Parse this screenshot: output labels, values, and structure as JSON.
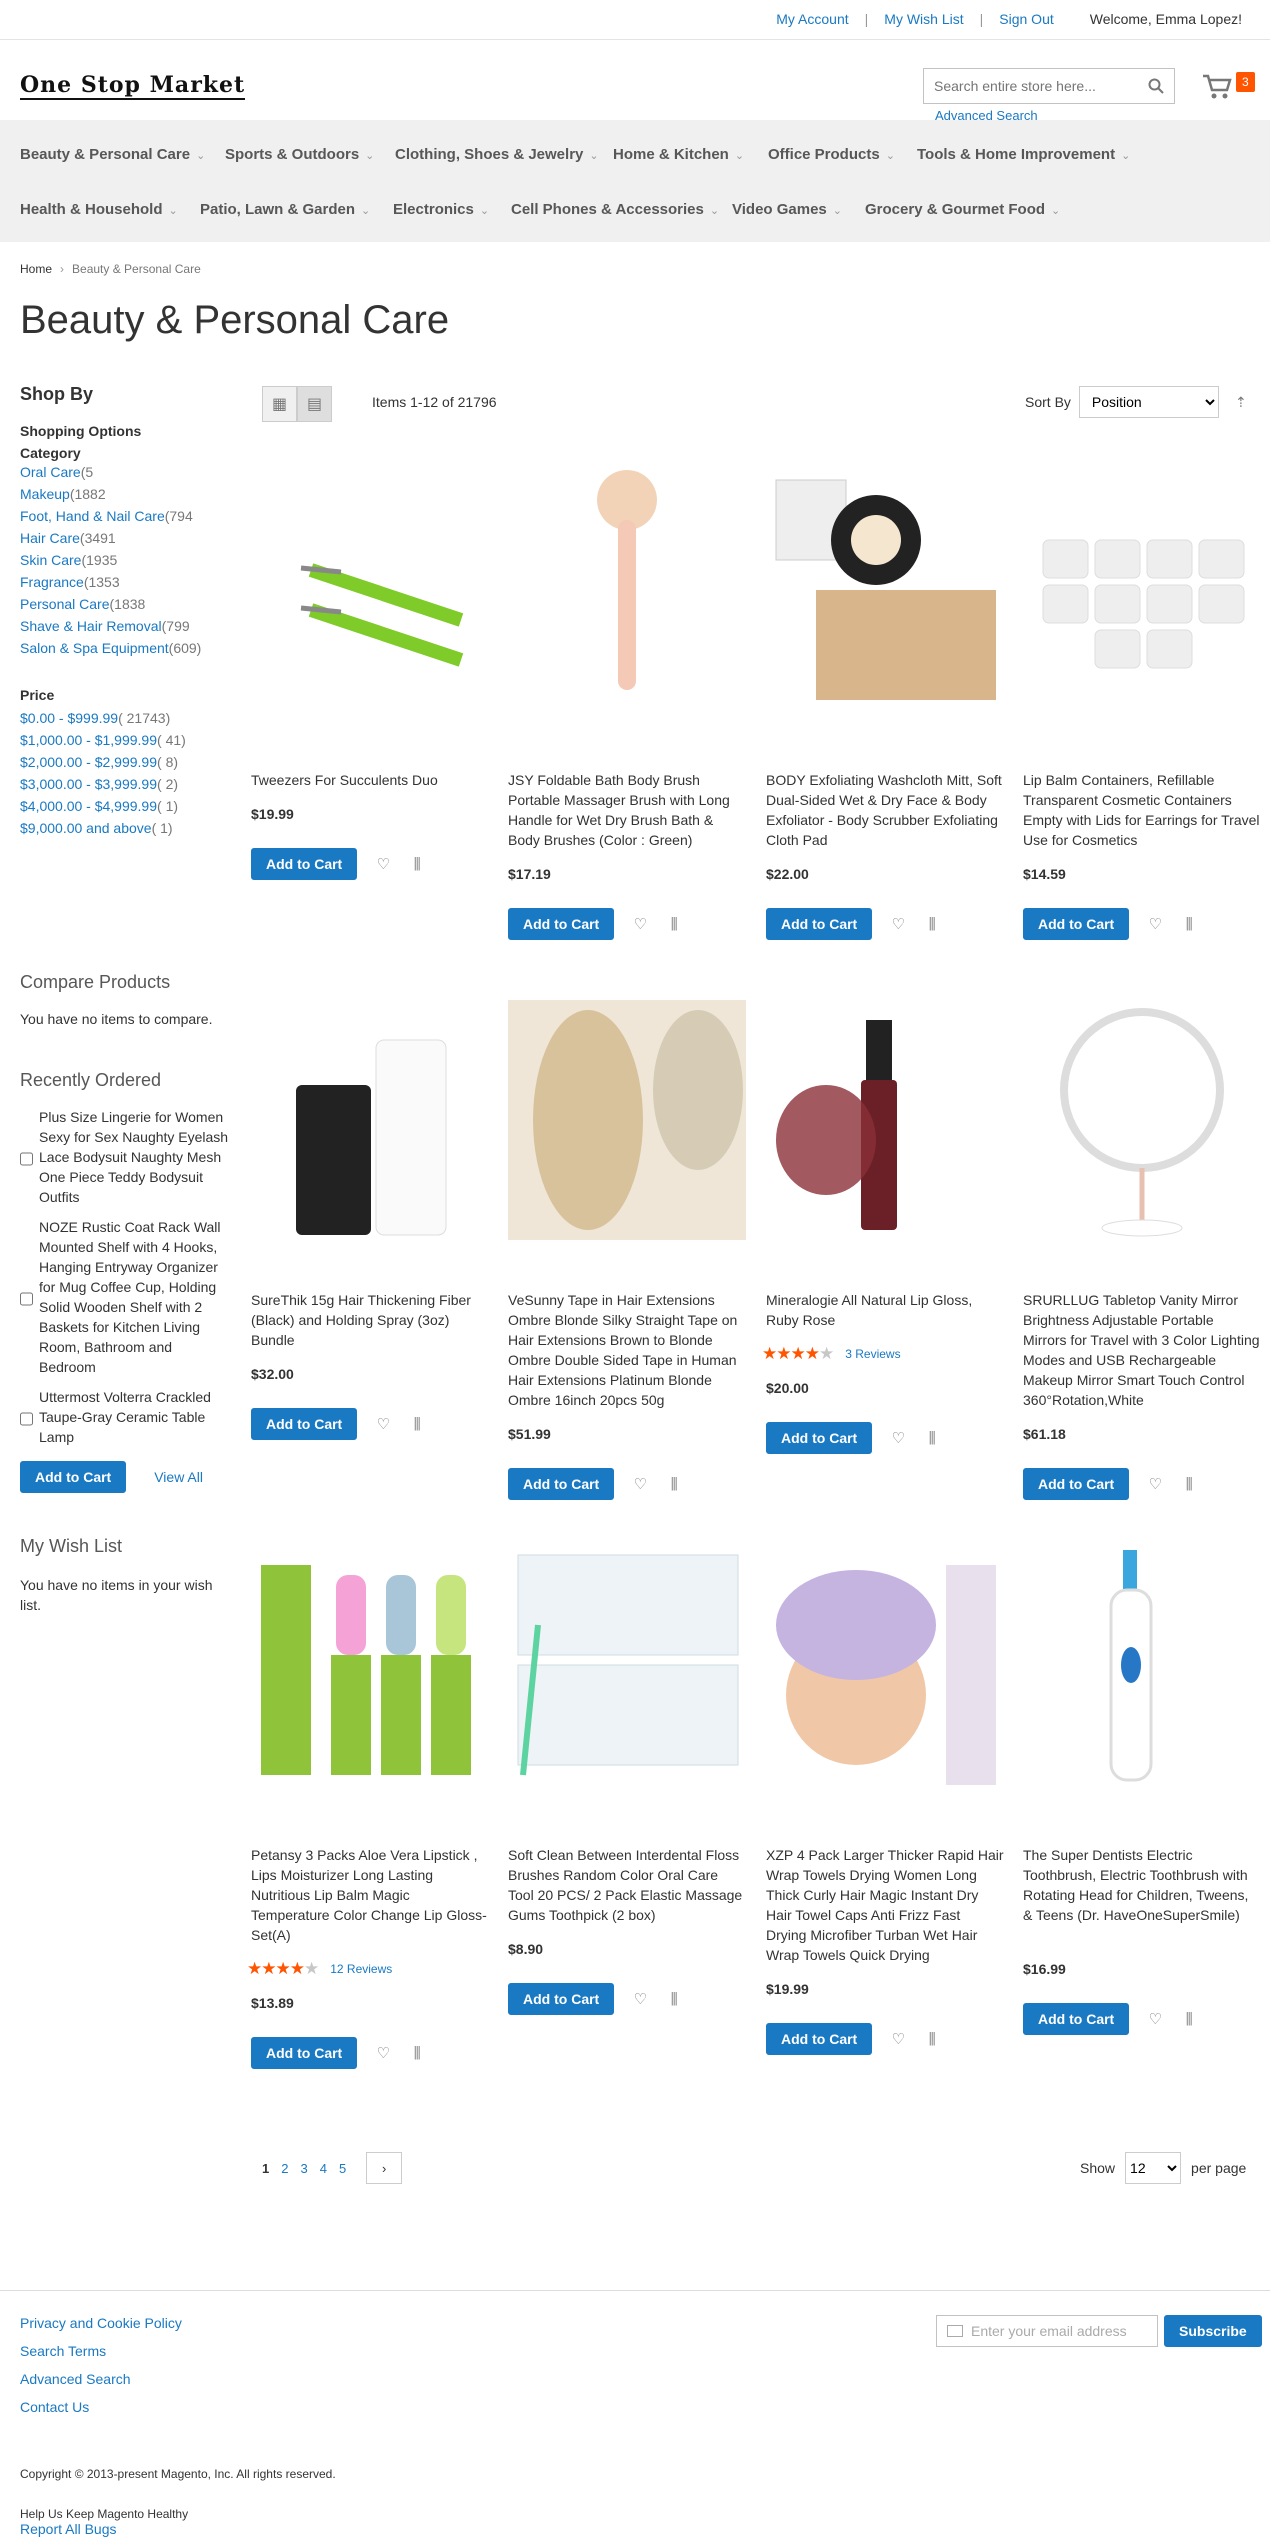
{
  "header": {
    "my_account": "My Account",
    "my_wish_list": "My Wish List",
    "sign_out": "Sign Out",
    "welcome": "Welcome, Emma Lopez!",
    "logo": "One Stop Market",
    "search_placeholder": "Search entire store here...",
    "advanced_search": "Advanced Search",
    "cart_count": "3"
  },
  "nav": {
    "items": [
      "Beauty & Personal Care",
      "Sports & Outdoors",
      "Clothing, Shoes & Jewelry",
      "Home & Kitchen",
      "Office Products",
      "Tools & Home Improvement",
      "Health & Household",
      "Patio, Lawn & Garden",
      "Electronics",
      "Cell Phones & Accessories",
      "Video Games",
      "Grocery & Gourmet Food"
    ]
  },
  "breadcrumb": {
    "home": "Home",
    "current": "Beauty & Personal Care"
  },
  "page_title": "Beauty & Personal Care",
  "sidebar": {
    "shop_by": "Shop By",
    "shopping_options": "Shopping Options",
    "category_title": "Category",
    "categories": [
      {
        "label": "Oral Care",
        "count": "(5"
      },
      {
        "label": "Makeup",
        "count": "(1882"
      },
      {
        "label": "Foot, Hand & Nail Care",
        "count": "(794"
      },
      {
        "label": "Hair Care",
        "count": "(3491"
      },
      {
        "label": "Skin Care",
        "count": "(1935"
      },
      {
        "label": "Fragrance",
        "count": "(1353"
      },
      {
        "label": "Personal Care",
        "count": "(1838"
      },
      {
        "label": "Shave & Hair Removal",
        "count": "(799"
      },
      {
        "label": "Salon & Spa Equipment",
        "count": "(609)"
      }
    ],
    "price_title": "Price",
    "prices": [
      {
        "label": "$0.00 - $999.99",
        "count": "( 21743)"
      },
      {
        "label": "$1,000.00 - $1,999.99",
        "count": "( 41)"
      },
      {
        "label": "$2,000.00 - $2,999.99",
        "count": "( 8)"
      },
      {
        "label": "$3,000.00 - $3,999.99",
        "count": "( 2)"
      },
      {
        "label": "$4,000.00 - $4,999.99",
        "count": "( 1)"
      },
      {
        "label": "$9,000.00 and above",
        "count": "( 1)"
      }
    ],
    "compare_title": "Compare Products",
    "compare_empty": "You have no items to compare.",
    "recent_title": "Recently Ordered",
    "recent_items": [
      "Plus Size Lingerie for Women Sexy for Sex Naughty Eyelash Lace Bodysuit Naughty Mesh One Piece Teddy Bodysuit Outfits",
      "NOZE Rustic Coat Rack Wall Mounted Shelf with 4 Hooks, Hanging Entryway Organizer for Mug Coffee Cup, Holding Solid Wooden Shelf with 2 Baskets for Kitchen Living Room, Bathroom and Bedroom",
      "Uttermost Volterra Crackled Taupe-Gray Ceramic Table Lamp"
    ],
    "recent_add": "Add to Cart",
    "recent_view_all": "View All",
    "wish_title": "My Wish List",
    "wish_empty": "You have no items in your wish list."
  },
  "toolbar": {
    "amount": "Items 1-12 of 21796",
    "sort_label": "Sort By",
    "sort_value": "Position",
    "show_label": "Show",
    "limit_value": "12",
    "per_page": "per page",
    "pages": [
      "1",
      "2",
      "3",
      "4",
      "5"
    ]
  },
  "products": [
    {
      "name": "Tweezers For Succulents Duo",
      "price": "$19.99"
    },
    {
      "name": "JSY Foldable Bath Body Brush Portable Massager Brush with Long Handle for Wet Dry Brush Bath & Body Brushes (Color : Green)",
      "price": "$17.19"
    },
    {
      "name": "BODY Exfoliating Washcloth Mitt, Soft Dual-Sided Wet & Dry Face & Body Exfoliator - Body Scrubber Exfoliating Cloth Pad",
      "price": "$22.00"
    },
    {
      "name": "Lip Balm Containers, Refillable Transparent Cosmetic Containers Empty with Lids for Earrings for Travel Use for Cosmetics",
      "price": "$14.59"
    },
    {
      "name": "SureThik 15g Hair Thickening Fiber (Black) and Holding Spray (3oz) Bundle",
      "price": "$32.00"
    },
    {
      "name": "VeSunny Tape in Hair Extensions Ombre Blonde Silky Straight Tape on Hair Extensions Brown to Blonde Ombre Double Sided Tape in Human Hair Extensions Platinum Blonde Ombre 16inch 20pcs 50g",
      "price": "$51.99"
    },
    {
      "name": "Mineralogie All Natural Lip Gloss, Ruby Rose",
      "price": "$20.00",
      "reviews": "3  Reviews",
      "rating": 4
    },
    {
      "name": "SRURLLUG Tabletop Vanity Mirror Brightness Adjustable Portable Mirrors for Travel with 3 Color Lighting Modes and USB Rechargeable Makeup Mirror Smart Touch Control 360°Rotation,White",
      "price": "$61.18"
    },
    {
      "name": "Petansy 3 Packs Aloe Vera Lipstick , Lips Moisturizer Long Lasting Nutritious Lip Balm Magic Temperature Color Change Lip Gloss-Set(A)",
      "price": "$13.89",
      "reviews": "12  Reviews",
      "rating": 3.5
    },
    {
      "name": "Soft Clean Between Interdental Floss Brushes Random Color Oral Care Tool 20 PCS/ 2 Pack Elastic Massage Gums Toothpick (2 box)",
      "price": "$8.90"
    },
    {
      "name": "XZP 4 Pack Larger Thicker Rapid Hair Wrap Towels Drying Women Long Thick Curly Hair Magic Instant Dry Hair Towel Caps Anti Frizz Fast Drying Microfiber Turban Wet Hair Wrap Towels Quick Drying",
      "price": "$19.99"
    },
    {
      "name": "The Super Dentists Electric Toothbrush, Electric Toothbrush with Rotating Head for Children, Tweens, & Teens (Dr. HaveOneSuperSmile)",
      "price": "$16.99"
    }
  ],
  "add_to_cart": "Add to Cart",
  "footer": {
    "links": [
      "Privacy and Cookie Policy",
      "Search Terms",
      "Advanced Search",
      "Contact Us"
    ],
    "newsletter_placeholder": "Enter your email address",
    "subscribe": "Subscribe",
    "copyright": "Copyright © 2013-present Magento, Inc. All rights reserved.",
    "help_text": "Help Us Keep Magento Healthy",
    "report": "Report All Bugs"
  },
  "colors": {
    "link": "#1979c3",
    "button": "#1979c3",
    "badge": "#ff5501",
    "star": "#ff5501"
  }
}
